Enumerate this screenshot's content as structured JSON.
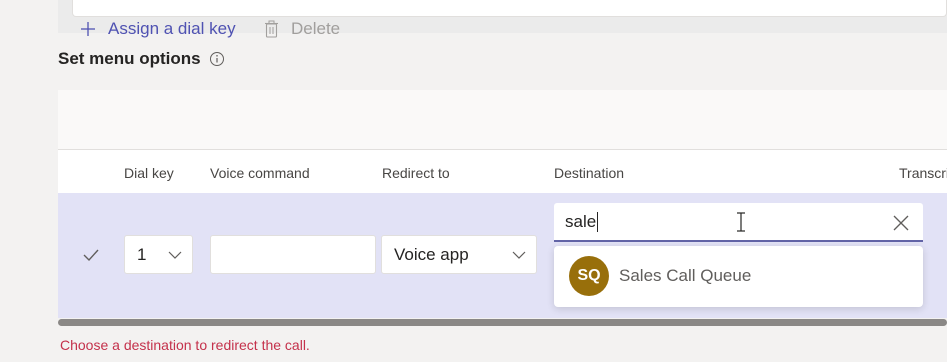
{
  "section": {
    "title": "Set menu options"
  },
  "toolbar": {
    "assign_label": "Assign a dial key",
    "delete_label": "Delete"
  },
  "table": {
    "headers": [
      "Dial key",
      "Voice command",
      "Redirect to",
      "Destination",
      "Transcri"
    ],
    "row": {
      "dial_key": "1",
      "voice_command": "",
      "redirect_to": "Voice app",
      "destination_query": "sale"
    }
  },
  "suggestions": [
    {
      "initials": "SQ",
      "label": "Sales Call Queue",
      "color": "#986f0b"
    }
  ],
  "error": "Choose a destination to redirect the call.",
  "colors": {
    "accent": "#6264a7",
    "link": "#4f52b2",
    "error": "#c4314b",
    "row_selected": "#e2e2f6"
  },
  "icons": [
    "info-icon",
    "plus-icon",
    "trash-icon",
    "check-icon",
    "chevron-down-icon",
    "close-icon",
    "text-cursor-icon"
  ]
}
